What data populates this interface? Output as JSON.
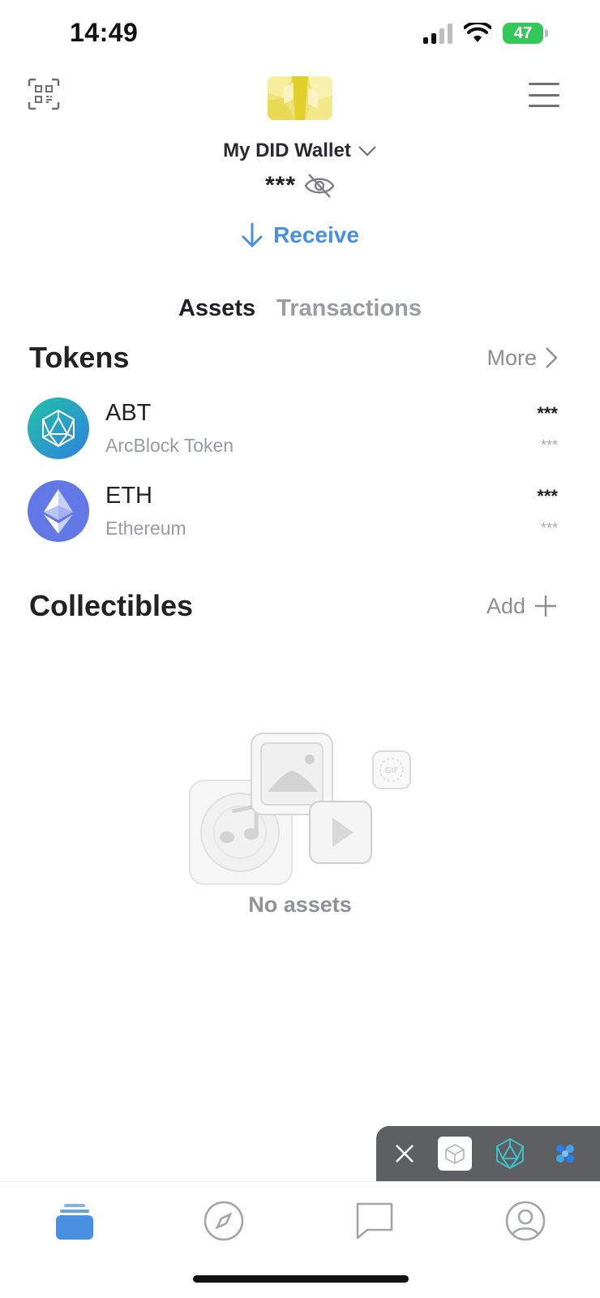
{
  "status_bar": {
    "time": "14:49",
    "battery": "47"
  },
  "header": {
    "wallet_name": "My DID Wallet",
    "balance_masked": "***",
    "receive_label": "Receive"
  },
  "tabs": [
    {
      "label": "Assets",
      "active": true
    },
    {
      "label": "Transactions",
      "active": false
    }
  ],
  "tokens": {
    "title": "Tokens",
    "more_label": "More",
    "items": [
      {
        "symbol": "ABT",
        "name": "ArcBlock Token",
        "balance": "***",
        "fiat": "***",
        "icon": "arcblock-icon"
      },
      {
        "symbol": "ETH",
        "name": "Ethereum",
        "balance": "***",
        "fiat": "***",
        "icon": "ethereum-icon"
      }
    ]
  },
  "collectibles": {
    "title": "Collectibles",
    "add_label": "Add",
    "empty_text": "No assets"
  },
  "colors": {
    "accent": "#4a90e2",
    "abt_gradient": [
      "#22c3a6",
      "#2f7fe0"
    ],
    "eth": "#6278e6",
    "battery": "#34c759"
  }
}
